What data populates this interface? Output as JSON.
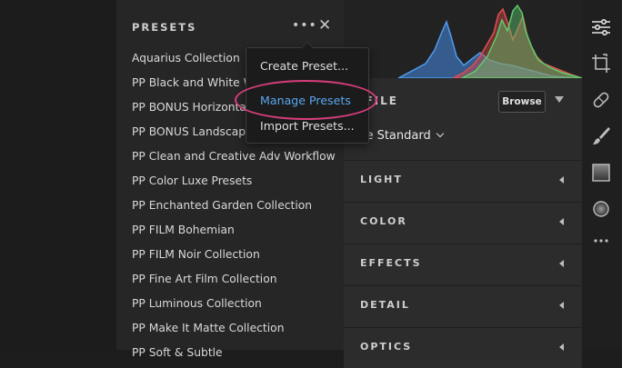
{
  "presets_panel": {
    "title": "PRESETS",
    "more_label": "•••",
    "close_label": "✕",
    "items": [
      "Aquarius Collection",
      "PP Black and White Wo",
      "PP BONUS Horizontal P",
      "PP BONUS Landscape",
      "PP Clean and Creative Adv Workflow",
      "PP Color Luxe Presets",
      "PP Enchanted Garden Collection",
      "PP FILM Bohemian",
      "PP FILM Noir Collection",
      "PP Fine Art Film Collection",
      "PP Luminous Collection",
      "PP Make It Matte Collection",
      "PP Soft & Subtle"
    ]
  },
  "menu": {
    "items": [
      "Create Preset...",
      "Manage Presets",
      "Import Presets..."
    ],
    "highlighted": "Manage Presets"
  },
  "edit_panel": {
    "profile_label": "ROFILE",
    "browse_label": "Browse",
    "profile_value": "dobe Standard",
    "sections": [
      "LIGHT",
      "COLOR",
      "EFFECTS",
      "DETAIL",
      "OPTICS"
    ]
  },
  "toolbar": {
    "icons": [
      "edit-sliders-icon",
      "crop-icon",
      "healing-icon",
      "brush-icon",
      "linear-gradient-icon",
      "radial-gradient-icon",
      "more-icon"
    ]
  },
  "colors": {
    "accent_blue": "#5aa7f0",
    "highlight_pink": "#d63d7d"
  }
}
